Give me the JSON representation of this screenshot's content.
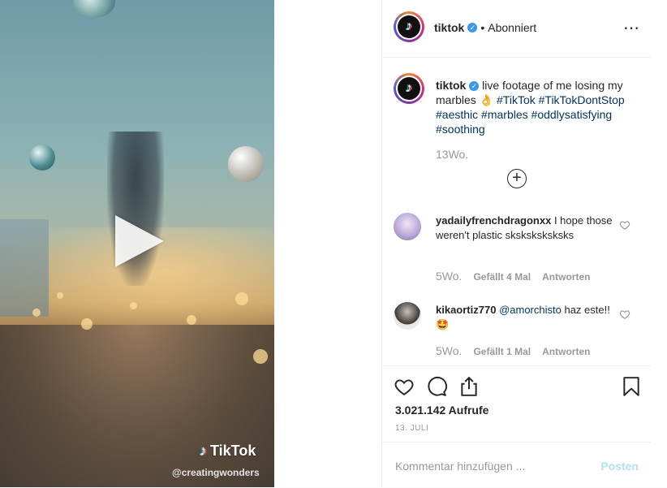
{
  "video": {
    "watermark_logo": "TikTok",
    "watermark_user": "@creatingwonders",
    "icons": [
      "play-icon",
      "tiktok-logo-icon"
    ]
  },
  "header": {
    "username": "tiktok",
    "separator": "•",
    "follow_status": "Abonniert",
    "more": "⋯"
  },
  "caption": {
    "username": "tiktok",
    "text": "live footage of me losing my marbles 👌",
    "hashtags": [
      "#TikTok",
      "#TikTokDontStop",
      "#aesthic",
      "#marbles",
      "#oddlysatisfying",
      "#soothing"
    ],
    "time": "13Wo."
  },
  "comments": [
    {
      "username": "yadailyfrenchdragonxx",
      "text": "I hope those weren't plastic sksksksksksks",
      "time": "5Wo.",
      "likes": "Gefällt 4 Mal",
      "reply": "Antworten"
    },
    {
      "username": "kikaortiz770",
      "mention": "@amorchisto",
      "text": "haz este!! 🤩",
      "time": "5Wo.",
      "likes": "Gefällt 1 Mal",
      "reply": "Antworten"
    }
  ],
  "actions": {
    "icons": [
      "heart-icon",
      "comment-icon",
      "share-icon",
      "bookmark-icon"
    ],
    "views": "3.021.142 Aufrufe",
    "date": "13. JULI"
  },
  "add_comment": {
    "placeholder": "Kommentar hinzufügen ...",
    "post_label": "Posten"
  },
  "colors": {
    "link": "#003569",
    "verified": "#3897f0",
    "post_disabled": "#b2dffc",
    "muted": "#999999"
  }
}
